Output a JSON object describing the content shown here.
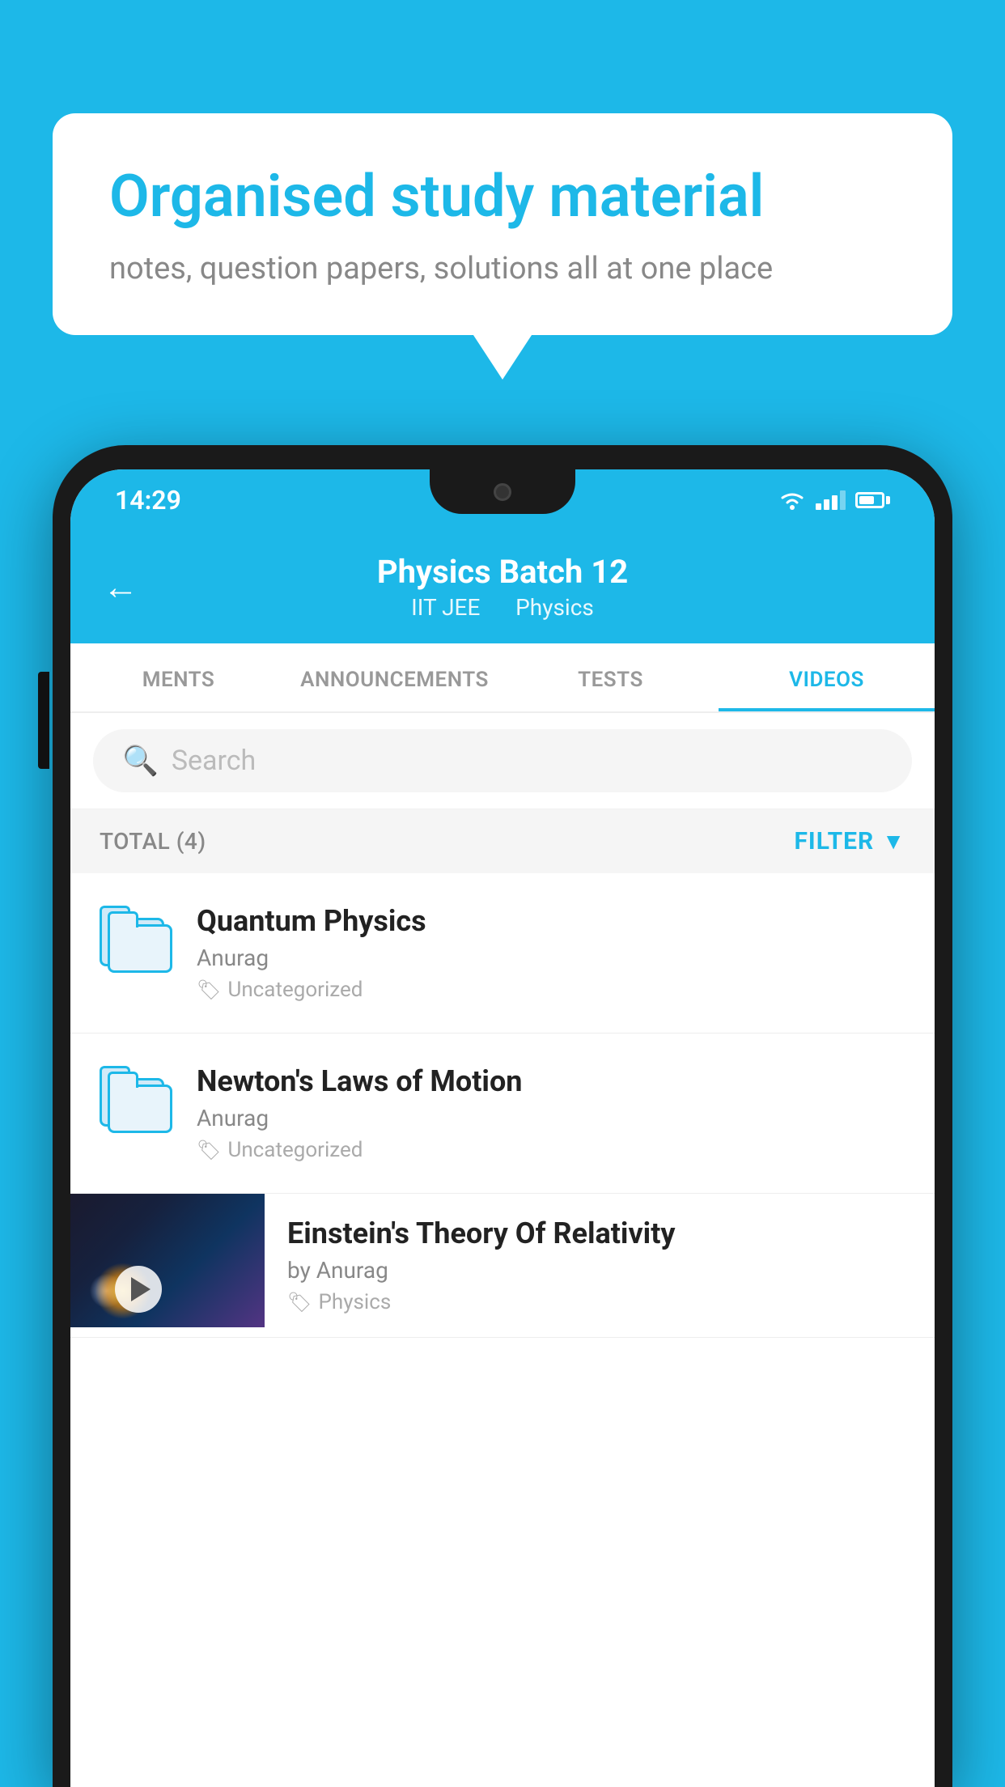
{
  "background_color": "#1db8e8",
  "speech_bubble": {
    "heading": "Organised study material",
    "subtext": "notes, question papers, solutions all at one place"
  },
  "phone": {
    "status_bar": {
      "time": "14:29"
    },
    "header": {
      "title": "Physics Batch 12",
      "subtitle_part1": "IIT JEE",
      "subtitle_part2": "Physics",
      "back_label": "←"
    },
    "tabs": [
      {
        "label": "MENTS",
        "active": false
      },
      {
        "label": "ANNOUNCEMENTS",
        "active": false
      },
      {
        "label": "TESTS",
        "active": false
      },
      {
        "label": "VIDEOS",
        "active": true
      }
    ],
    "search": {
      "placeholder": "Search"
    },
    "filter_row": {
      "total_label": "TOTAL (4)",
      "filter_label": "FILTER"
    },
    "videos": [
      {
        "title": "Quantum Physics",
        "author": "Anurag",
        "tag": "Uncategorized",
        "has_thumbnail": false
      },
      {
        "title": "Newton's Laws of Motion",
        "author": "Anurag",
        "tag": "Uncategorized",
        "has_thumbnail": false
      },
      {
        "title": "Einstein's Theory Of Relativity",
        "author": "by Anurag",
        "tag": "Physics",
        "has_thumbnail": true
      }
    ]
  }
}
